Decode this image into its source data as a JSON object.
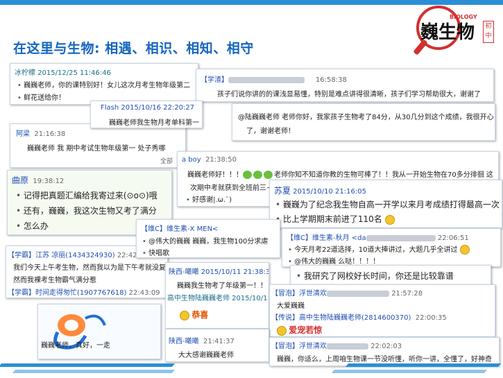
{
  "title": "在这里与生物: 相遇、相识、相知、相守",
  "logo": {
    "cn": "巍生物",
    "en": "BIOLOGY",
    "badge": "初中"
  },
  "cards": {
    "c1": {
      "user": "冰柠檬",
      "time": "2015/12/25 11:46:46",
      "l1": "巍巍老师，你的课特别好！女儿这次月考生物年级第二",
      "l2": "鲜花送给你！"
    },
    "c2": {
      "tag": "【学渣】",
      "time": "16:58:38",
      "l1": "孩子们说你讲的的课浅显易懂，特别是难点讲得很清晰，孩子们学习帮助很大，谢谢了"
    },
    "c3": {
      "user": "Flash",
      "time": "2015/10/16 22:20:27",
      "l1": "巍巍老师我生物月考单科第一"
    },
    "c4": {
      "l1": "@陆巍巍老师 老师你好，我家孩子生物考了84分，从30几分到这个成绩，我很开心",
      "l2": "了，谢谢老师！"
    },
    "c5": {
      "user": "阿梁",
      "time": "21:16:38",
      "l1": "巍巍老师 我 期中考试生物年级第一 处子秀哪",
      "l2": "全部"
    },
    "c6": {
      "user": "a boy",
      "time": "21:38:50",
      "l1a": "巍巍老师好！！！",
      "l1b": "老师你知不知道你教的生物可棒了！！我从一开始生物在70多分徘徊 这",
      "l2": "次期中考就获到全班前三~",
      "l3": "好感谢|.ω.`)"
    },
    "c7": {
      "user": "曲原",
      "time": "19:38:12",
      "l1": "记得把真题汇编给我寄过来(⊙o⊙)哦",
      "l2": "还有，巍巍，我这次生物又考了满分",
      "l3": "怎么办"
    },
    "c8": {
      "user": "苏夏",
      "time": "2015/10/10 21:16:05",
      "l1": "巍巍为了纪念我生物自高一开学以来月考成绩打得最高一次",
      "l2": "比上学期期末前进了110名"
    },
    "c9": {
      "tag1": "【学霸】",
      "user1": "江苏",
      "user1b": "凉丽(1434324930)",
      "time1": "22:42:43",
      "l1": "我们今天上午考生物，然而我以为是下午考就没复",
      "l2": "然而我裸考生物霸气满分惹",
      "tag2": "【学霸】",
      "user2": "时间走得匆忙(1907767618)",
      "time2": "22:43:09"
    },
    "c10": {
      "tag": "【维C】",
      "user": "维生素-X MEN<",
      "l1": "@伟大的巍巍 巍巍，我生物100分求虐",
      "l2": "快唱歌"
    },
    "c11": {
      "tag": "【维C】",
      "user": "维生素-秋月 <da",
      "time": "22:06:51",
      "l1": "今天月考22道选择，10道大捧讲过，大题几乎全讲过",
      "l2": "@伟大的巍巍 么哒！！！！"
    },
    "c12": {
      "user": "陕西-曦曦",
      "time": "2015/10/11 21:38:37",
      "l1": "巍巍我生物考了年级第一！！",
      "l2": "高中生物陆巍巍老师 2015/10/11",
      "l3": "恭喜"
    },
    "c13": {
      "l1": "我研究了网校好长时间，你还是比较靠谱"
    },
    "c14": {
      "tag": "【冒泡】",
      "user": "浮世清欢",
      "time": "21:57:28",
      "l1": "大爱巍巍",
      "tag2": "【传说】",
      "user2": "高中生物陆巍巍老师(2814600370)",
      "time2": "22:00:35",
      "l2": "爱宠若惊"
    },
    "c15": {
      "user": "陕西-曦曦",
      "time": "21:41:37",
      "l1": "大大感谢巍巍老师"
    },
    "c16": {
      "tag": "【冒泡】",
      "user": "浮世清欢",
      "time": "22:02:03",
      "l1": "巍巍，你适么，上周咱生物课一节没听懂，听你一讲，全懂了，好神奇"
    },
    "c17": {
      "l1": "巍巍老师，真好，一走"
    }
  }
}
